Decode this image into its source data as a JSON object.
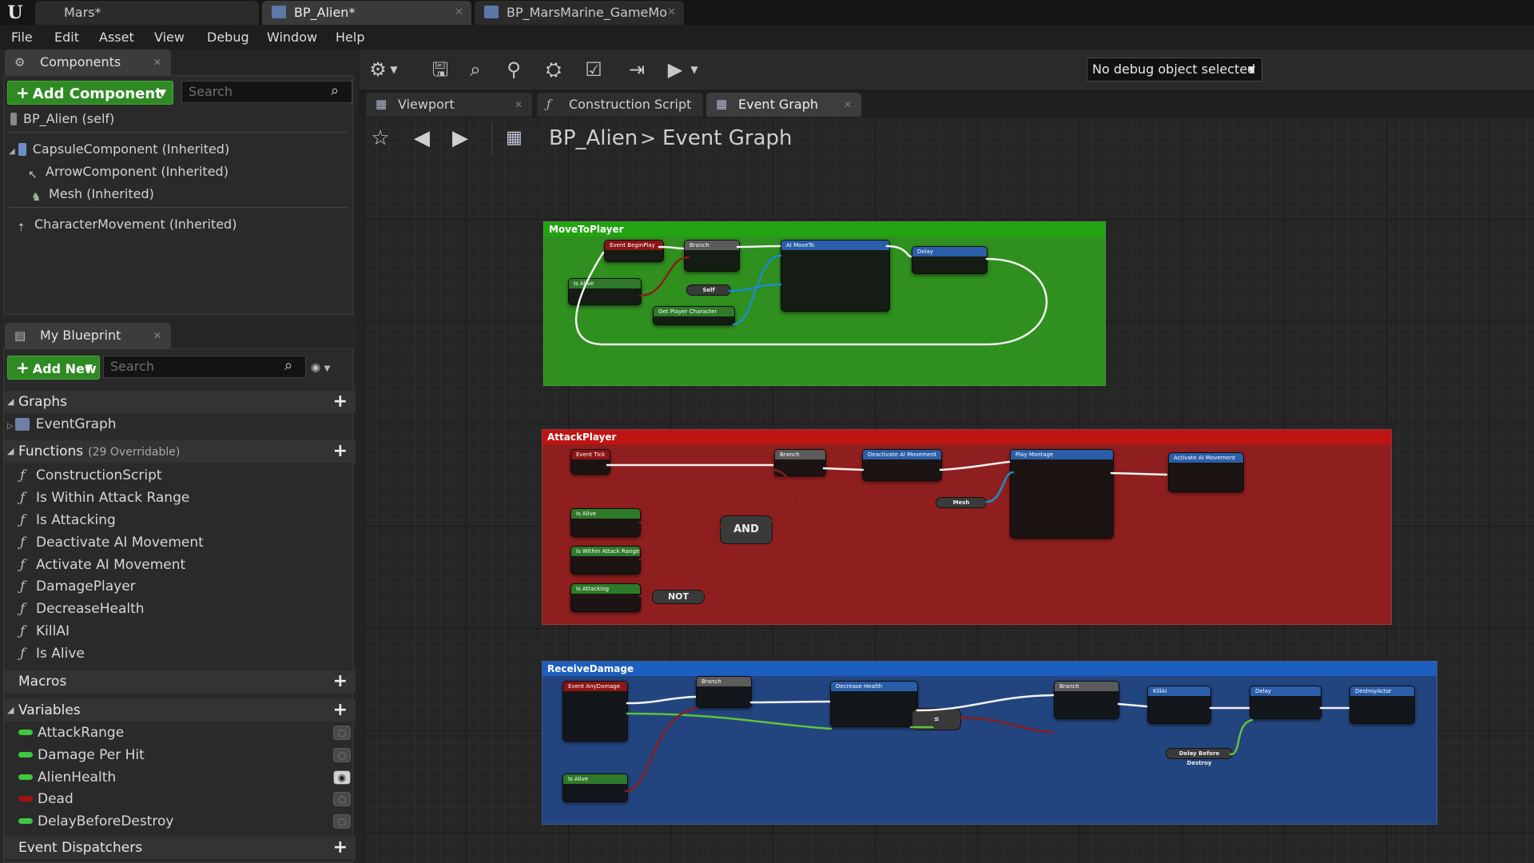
{
  "titlebar": {
    "logo": "U",
    "tabs": [
      {
        "label": "Mars*"
      },
      {
        "label": "BP_Alien*"
      },
      {
        "label": "BP_MarsMarine_GameMo"
      }
    ]
  },
  "menu": [
    "File",
    "Edit",
    "Asset",
    "View",
    "Debug",
    "Window",
    "Help"
  ],
  "components": {
    "tab": "Components",
    "add_button": "Add Component",
    "search_placeholder": "Search",
    "items": [
      "BP_Alien (self)",
      "CapsuleComponent (Inherited)",
      "ArrowComponent (Inherited)",
      "Mesh (Inherited)",
      "CharacterMovement (Inherited)"
    ]
  },
  "my_blueprint": {
    "tab": "My Blueprint",
    "add_button": "Add New",
    "search_placeholder": "Search",
    "graphs_header": "Graphs",
    "graphs": [
      "EventGraph"
    ],
    "functions_header": "Functions",
    "functions_sub": "(29 Overridable)",
    "functions": [
      "ConstructionScript",
      "Is Within Attack Range",
      "Is Attacking",
      "Deactivate AI Movement",
      "Activate AI Movement",
      "DamagePlayer",
      "DecreaseHealth",
      "KillAI",
      "Is Alive"
    ],
    "macros_header": "Macros",
    "variables_header": "Variables",
    "variables": [
      {
        "name": "AttackRange",
        "color": "#3ec63e",
        "visible": false
      },
      {
        "name": "Damage Per Hit",
        "color": "#3ec63e",
        "visible": false
      },
      {
        "name": "AlienHealth",
        "color": "#3ec63e",
        "visible": true
      },
      {
        "name": "Dead",
        "color": "#a31010",
        "visible": false
      },
      {
        "name": "DelayBeforeDestroy",
        "color": "#3ec63e",
        "visible": false
      }
    ],
    "dispatchers_header": "Event Dispatchers"
  },
  "toolbar": {
    "debug_combo": "No debug object selected"
  },
  "editor_tabs": [
    "Viewport",
    "Construction Script",
    "Event Graph"
  ],
  "breadcrumb": {
    "root": "BP_Alien",
    "sep": ">",
    "leaf": "Event Graph"
  },
  "comments": [
    {
      "title": "MoveToPlayer",
      "color": "#2f8f1f",
      "header": "#22a312"
    },
    {
      "title": "AttackPlayer",
      "color": "#8f1f1f",
      "header": "#c01313"
    },
    {
      "title": "ReceiveDamage",
      "color": "#23457f",
      "header": "#1d5fbf"
    }
  ],
  "nodes": {
    "move": {
      "event": "Event BeginPlay",
      "branch": "Branch",
      "ai_move": "AI MoveTo",
      "delay": "Delay",
      "is_alive": "Is Alive",
      "get_player": "Get Player Character",
      "self": "Self"
    },
    "attack": {
      "event": "Event Tick",
      "branch": "Branch",
      "deactivate": "Deactivate AI Movement",
      "montage": "Play Montage",
      "activate": "Activate AI Movement",
      "is_alive": "Is Alive",
      "in_range": "Is Within Attack Range",
      "attacking": "Is Attacking",
      "and": "AND",
      "not": "NOT",
      "mesh": "Mesh"
    },
    "damage": {
      "event": "Event AnyDamage",
      "branch1": "Branch",
      "decrease": "Decrease Health",
      "branch2": "Branch",
      "kill": "KillAI",
      "delay": "Delay",
      "destroy": "DestroyActor",
      "is_alive": "Is Alive",
      "delay_var": "Delay Before Destroy"
    }
  }
}
